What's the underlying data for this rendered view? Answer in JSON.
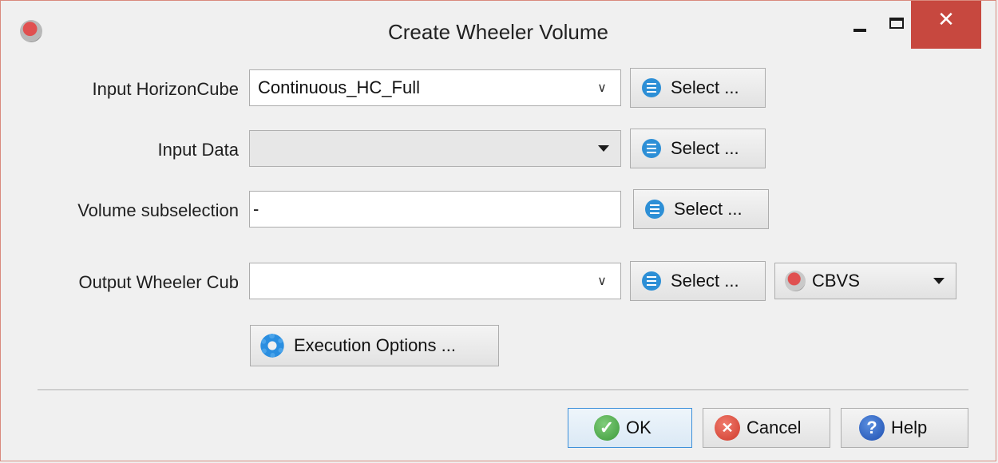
{
  "window": {
    "title": "Create Wheeler Volume",
    "minimize_label": "",
    "maximize_label": "",
    "close_label": "✕"
  },
  "form": {
    "horizon_cube": {
      "label": "Input HorizonCube",
      "value": "Continuous_HC_Full",
      "select_label": "Select ..."
    },
    "input_data": {
      "label": "Input Data",
      "value": "",
      "select_label": "Select ..."
    },
    "volume_subselection": {
      "label": "Volume subselection",
      "value": "-",
      "select_label": "Select ..."
    },
    "output_wheeler": {
      "label": "Output Wheeler Cub",
      "value": "",
      "select_label": "Select ...",
      "format_value": "CBVS"
    },
    "execution_options_label": "Execution Options ..."
  },
  "buttons": {
    "ok_label": "OK",
    "cancel_label": "Cancel",
    "help_label": "Help"
  },
  "colors": {
    "close_button": "#c7483f",
    "select_icon": "#2d8fd6",
    "ok_icon": "#3c9a39",
    "cancel_icon": "#cf3b2c",
    "help_icon": "#1f4fb0"
  }
}
